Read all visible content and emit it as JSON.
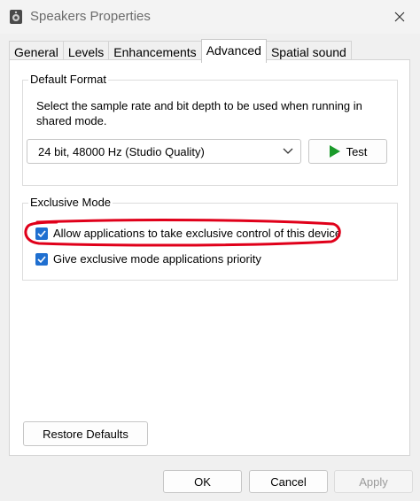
{
  "window": {
    "title": "Speakers Properties"
  },
  "tabs": [
    {
      "label": "General"
    },
    {
      "label": "Levels"
    },
    {
      "label": "Enhancements"
    },
    {
      "label": "Advanced"
    },
    {
      "label": "Spatial sound"
    }
  ],
  "default_format": {
    "heading": "Default Format",
    "description": "Select the sample rate and bit depth to be used when running in shared mode.",
    "selected_format": "24 bit, 48000 Hz (Studio Quality)",
    "test_label": "Test"
  },
  "exclusive_mode": {
    "heading": "Exclusive Mode",
    "allow_exclusive_label": "Allow applications to take exclusive control of this device",
    "allow_exclusive_checked": true,
    "priority_label": "Give exclusive mode applications priority",
    "priority_checked": true
  },
  "restore_defaults_label": "Restore Defaults",
  "footer": {
    "ok_label": "OK",
    "cancel_label": "Cancel",
    "apply_label": "Apply"
  },
  "colors": {
    "accent": "#1f6fd0",
    "play_icon": "#1a9a2a",
    "annotation": "#e0001a"
  }
}
